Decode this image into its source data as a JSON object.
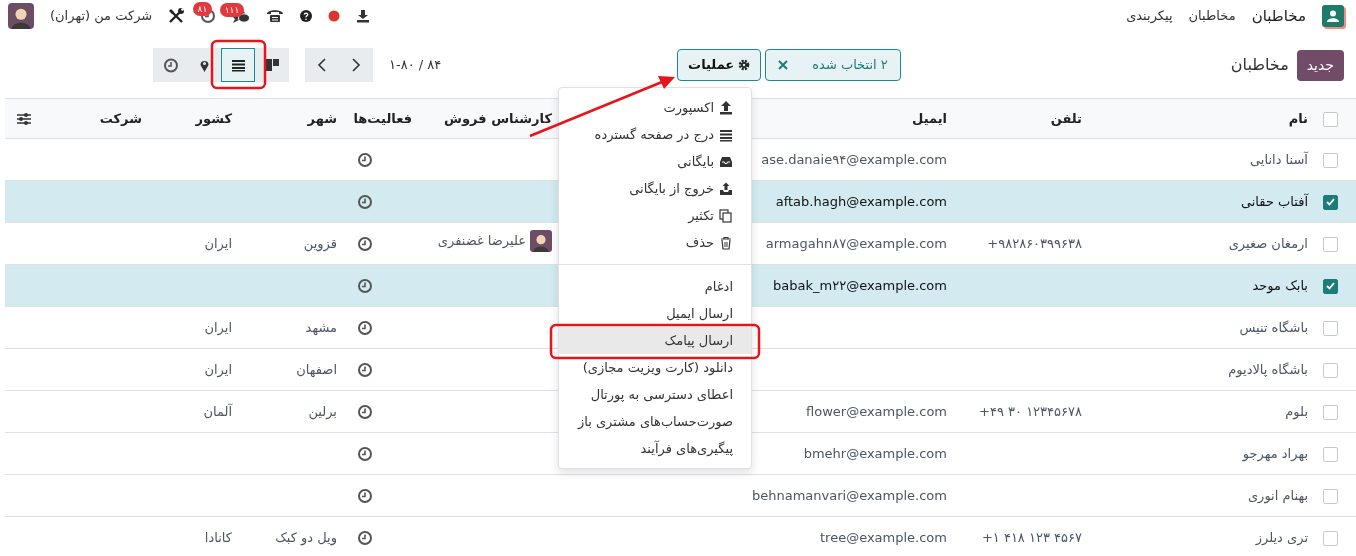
{
  "navbar": {
    "app_name": "مخاطبان",
    "menu": [
      "مخاطبان",
      "پیکربندی"
    ],
    "chat_badge": "۱۱۱",
    "activity_badge": "۸۱",
    "company": "شرکت من (تهران)"
  },
  "control_panel": {
    "new_button": "جدید",
    "breadcrumb": "مخاطبان",
    "selection": "۲ انتخاب شده",
    "actions_button": "عملیات",
    "pager": "۱-۸۰ / ۸۴",
    "views": [
      {
        "kind": "kanban",
        "selected": false
      },
      {
        "kind": "list",
        "selected": true
      },
      {
        "kind": "map",
        "selected": false
      },
      {
        "kind": "activity",
        "selected": false
      }
    ]
  },
  "table": {
    "all_selected": false,
    "columns": [
      "نام",
      "تلفن",
      "ایمیل",
      "کارشناس فروش",
      "فعالیت‌ها",
      "شهر",
      "کشور",
      "شرکت"
    ],
    "rows": [
      {
        "selected": false,
        "name": "آسنا دانایی",
        "email": "ase.danaie۹۴@example.com"
      },
      {
        "selected": true,
        "name": "آفتاب حقانی",
        "email": "aftab.hagh@example.com"
      },
      {
        "selected": false,
        "name": "ارمغان صغیری",
        "phone": "+۹۸۲۸۶۰۳۹۹۶۳۸",
        "email": "armagahn۸۷@example.com",
        "salesperson": "علیرضا غضنفری",
        "city": "قزوین",
        "country": "ایران"
      },
      {
        "selected": true,
        "name": "بابک موحد",
        "email": "babak_m۲۲@example.com"
      },
      {
        "selected": false,
        "name": "باشگاه تنیس",
        "city": "مشهد",
        "country": "ایران"
      },
      {
        "selected": false,
        "name": "باشگاه پالادیوم",
        "city": "اصفهان",
        "country": "ایران"
      },
      {
        "selected": false,
        "name": "بلوم",
        "phone": "+۴۹ ۳۰ ۱۲۳۴۵۶۷۸",
        "email": "flower@example.com",
        "city": "برلین",
        "country": "آلمان"
      },
      {
        "selected": false,
        "name": "بهراد مهرجو",
        "email": "bmehr@example.com"
      },
      {
        "selected": false,
        "name": "بهنام انوری",
        "email": "behnamanvari@example.com"
      },
      {
        "selected": false,
        "name": "تری دیلرز",
        "phone": "+۱ ۴۱۸ ۱۲۳ ۴۵۶۷",
        "email": "tree@example.com",
        "city": "ویل دو کبک",
        "country": "کانادا"
      }
    ]
  },
  "actions_menu": {
    "groups": [
      [
        {
          "kind": "export",
          "label": "اکسپورت",
          "highlighted": false
        },
        {
          "kind": "spreadsheet",
          "label": "درج در صفحه گسترده",
          "highlighted": false
        },
        {
          "kind": "archive",
          "label": "بایگانی",
          "highlighted": false
        },
        {
          "kind": "unarchive",
          "label": "خروج از بایگانی",
          "highlighted": false
        },
        {
          "kind": "duplicate",
          "label": "تکثیر",
          "highlighted": false
        },
        {
          "kind": "delete",
          "label": "حذف",
          "highlighted": false
        }
      ],
      [
        {
          "kind": "plain",
          "label": "ادغام",
          "highlighted": false
        },
        {
          "kind": "plain",
          "label": "ارسال ایمیل",
          "highlighted": false
        },
        {
          "kind": "plain",
          "label": "ارسال پیامک",
          "highlighted": true
        },
        {
          "kind": "plain",
          "label": "دانلود (کارت ویزیت مجازی)",
          "highlighted": false
        },
        {
          "kind": "plain",
          "label": "اعطای دسترسی به پورتال",
          "highlighted": false
        },
        {
          "kind": "plain",
          "label": "صورت‌حساب‌های مشتری باز",
          "highlighted": false
        },
        {
          "kind": "plain",
          "label": "پیگیری‌های فرآیند",
          "highlighted": false
        }
      ]
    ]
  }
}
